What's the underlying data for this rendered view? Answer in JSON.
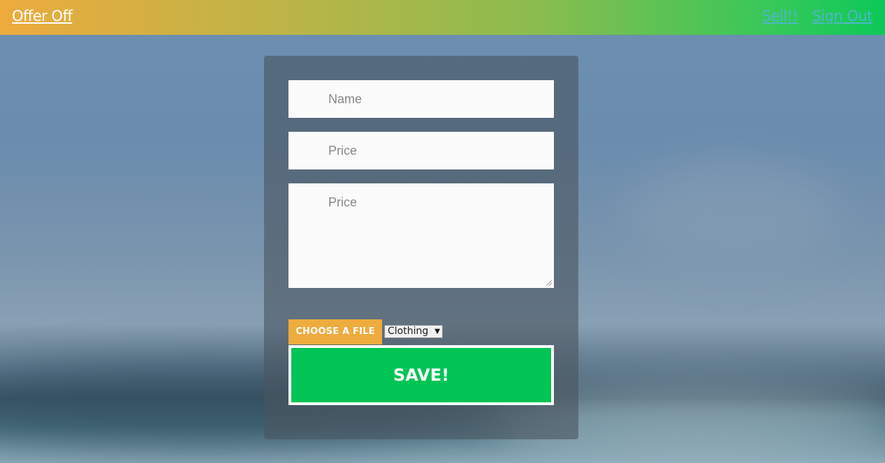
{
  "navbar": {
    "brand": "Offer Off",
    "links": [
      "Sell!!",
      "Sign Out"
    ]
  },
  "form": {
    "name_placeholder": "Name",
    "price_placeholder": "Price",
    "description_placeholder": "Price",
    "file_button_label": "CHOOSE A FILE",
    "category_selected": "Clothing",
    "save_label": "SAVE!"
  },
  "colors": {
    "navbar_gradient_start": "#eeab3e",
    "navbar_gradient_end": "#0cc858",
    "file_button": "#eeab3e",
    "save_button": "#00c454",
    "nav_link": "#4fb6c9"
  },
  "icons": {
    "select_arrow": "chevron-down-icon",
    "resize_grip": "resize-grip-icon"
  }
}
